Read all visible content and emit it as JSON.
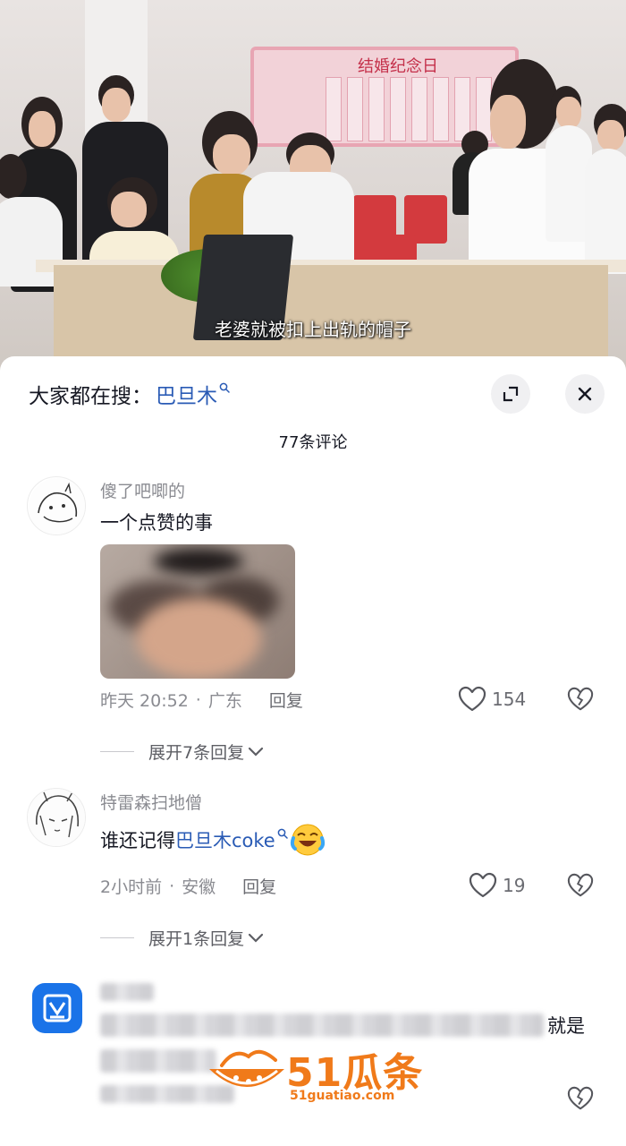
{
  "video": {
    "subtitle": "老婆就被扣上出轨的帽子",
    "wall_sign": "结婚纪念日"
  },
  "search": {
    "prefix": "大家都在搜：",
    "term": "巴旦木"
  },
  "comments_header": {
    "count_label": "77条评论"
  },
  "comments": [
    {
      "username": "傻了吧唧的",
      "text": "一个点赞的事",
      "time": "昨天 20:52",
      "location": "广东",
      "reply_label": "回复",
      "likes": "154",
      "expand_label": "展开7条回复"
    },
    {
      "username": "特雷森扫地僧",
      "text_prefix": "谁还记得",
      "text_link": "巴旦木coke",
      "emoji": "laughing-crying-emoji",
      "time": "2小时前",
      "location": "安徽",
      "reply_label": "回复",
      "likes": "19",
      "expand_label": "展开1条回复"
    },
    {
      "visible_tail": "就是"
    }
  ],
  "watermark": {
    "brand": "51瓜条",
    "url": "51guatiao.com"
  },
  "colors": {
    "link": "#2a5bb5",
    "watermark": "#f07a1a",
    "meta": "#8a8b91"
  },
  "icons": [
    "search-mini-icon",
    "expand-icon",
    "close-icon",
    "heart-icon",
    "broken-heart-icon",
    "chevron-down-icon"
  ]
}
